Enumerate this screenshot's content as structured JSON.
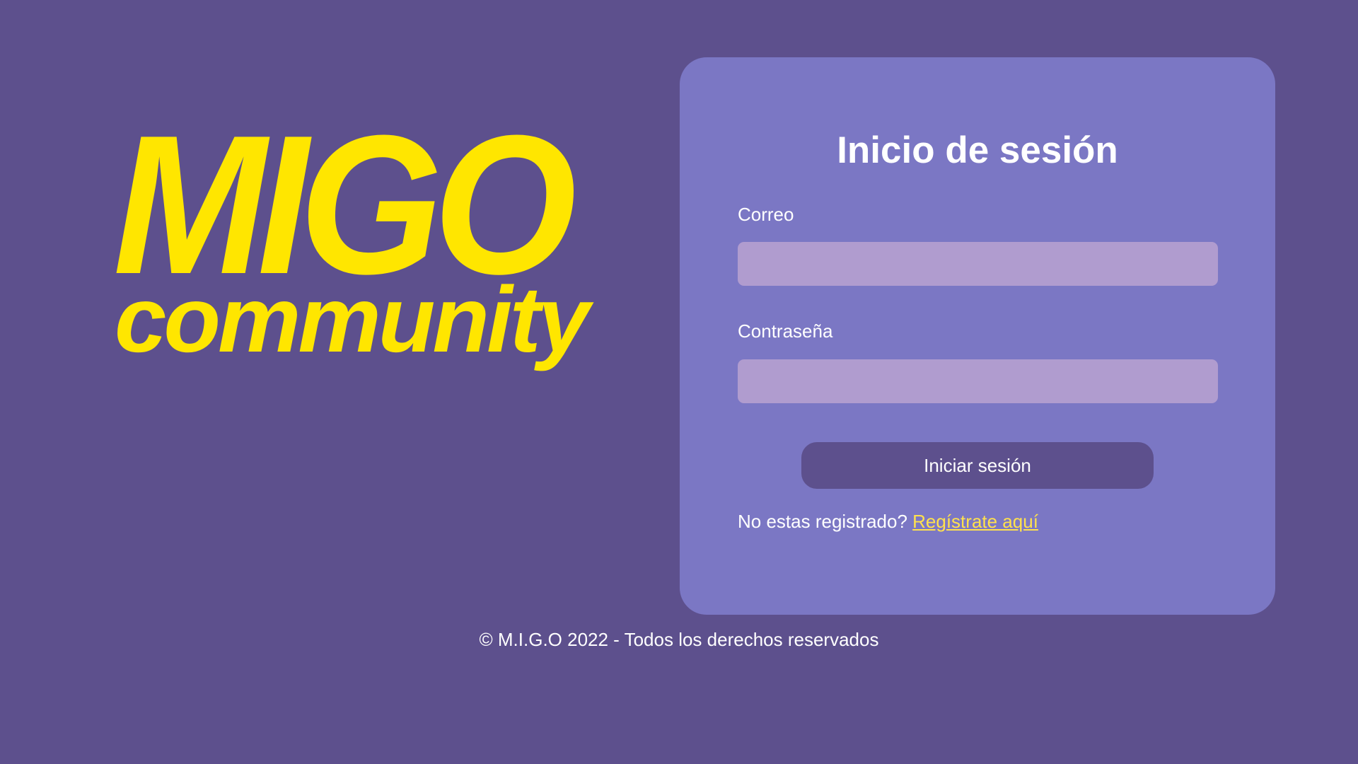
{
  "colors": {
    "background": "#5d508d",
    "card": "#7b77c4",
    "input": "#b09ccf",
    "button": "#5d508d",
    "logo": "#ffe600",
    "link": "#ffe14d"
  },
  "logo": {
    "main": "MIGO",
    "sub": "community"
  },
  "login": {
    "title": "Inicio de sesión",
    "email_label": "Correo",
    "email_value": "",
    "email_placeholder": "",
    "password_label": "Contraseña",
    "password_value": "",
    "password_placeholder": "",
    "submit_label": "Iniciar sesión",
    "register_prompt": "No estas registrado?",
    "register_link": "Regístrate aquí"
  },
  "footer": {
    "text": "© M.I.G.O 2022 - Todos los derechos reservados"
  }
}
